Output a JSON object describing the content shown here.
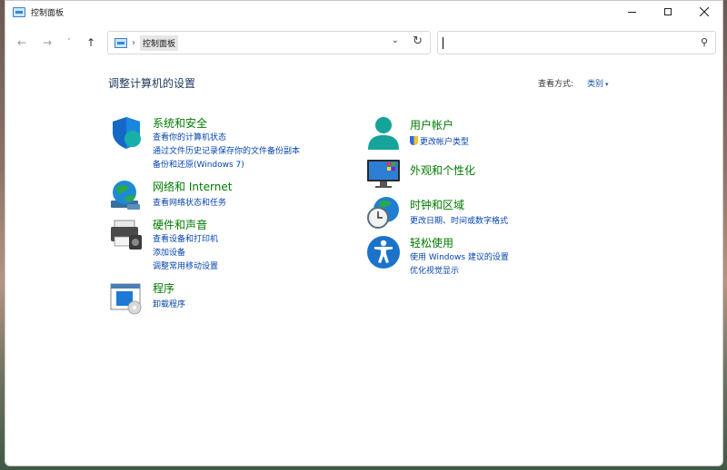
{
  "window": {
    "title": "控制面板"
  },
  "toolbar": {
    "back_icon": "←",
    "forward_icon": "→",
    "recent_icon": "˅",
    "up_icon": "↑",
    "breadcrumb": "控制面板",
    "breadcrumb_sep": "›",
    "dropdown_icon": "⌄",
    "refresh_icon": "↻",
    "search_placeholder": "",
    "search_icon": "⚲"
  },
  "main": {
    "heading": "调整计算机的设置",
    "view_by_label": "查看方式:",
    "view_by_value": "类别",
    "view_by_arrow": "▾"
  },
  "categories": {
    "system": {
      "title": "系统和安全",
      "links": [
        "查看你的计算机状态",
        "通过文件历史记录保存你的文件备份副本",
        "备份和还原(Windows 7)"
      ]
    },
    "network": {
      "title": "网络和 Internet",
      "links": [
        "查看网络状态和任务"
      ]
    },
    "hardware": {
      "title": "硬件和声音",
      "links": [
        "查看设备和打印机",
        "添加设备",
        "调整常用移动设置"
      ]
    },
    "programs": {
      "title": "程序",
      "links": [
        "卸载程序"
      ]
    },
    "users": {
      "title": "用户帐户",
      "links": [
        "更改帐户类型"
      ]
    },
    "appearance": {
      "title": "外观和个性化",
      "links": []
    },
    "clock": {
      "title": "时钟和区域",
      "links": [
        "更改日期、时间或数字格式"
      ]
    },
    "ease": {
      "title": "轻松使用",
      "links": [
        "使用 Windows 建议的设置",
        "优化视觉显示"
      ]
    }
  },
  "colors": {
    "category_title": "#007a00",
    "link": "#0645ad",
    "heading": "#1e395b"
  }
}
